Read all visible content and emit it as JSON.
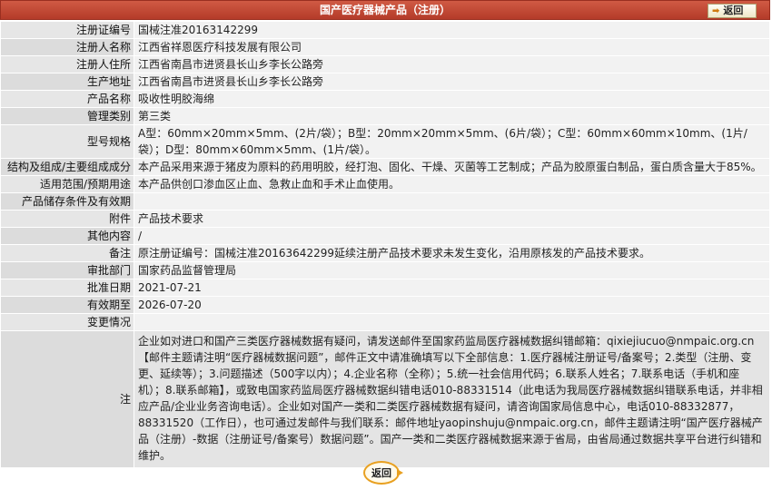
{
  "header": {
    "title": "国产医疗器械产品（注册）",
    "back_label": "返回"
  },
  "rows": [
    {
      "label": "注册证编号",
      "value": "国械注准20163142299"
    },
    {
      "label": "注册人名称",
      "value": "江西省祥恩医疗科技发展有限公司"
    },
    {
      "label": "注册人住所",
      "value": "江西省南昌市进贤县长山乡李长公路旁"
    },
    {
      "label": "生产地址",
      "value": "江西省南昌市进贤县长山乡李长公路旁"
    },
    {
      "label": "产品名称",
      "value": "吸收性明胶海绵"
    },
    {
      "label": "管理类别",
      "value": "第三类"
    },
    {
      "label": "型号规格",
      "value": "A型：60mm×20mm×5mm、(2片/袋）；B型：20mm×20mm×5mm、(6片/袋）；C型：60mm×60mm×10mm、(1片/袋）；D型：80mm×60mm×5mm、(1片/袋）。"
    },
    {
      "label": "结构及组成/主要组成成分",
      "value": "本产品采用来源于猪皮为原料的药用明胶，经打泡、固化、干燥、灭菌等工艺制成；产品为胶原蛋白制品，蛋白质含量大于85%。"
    },
    {
      "label": "适用范围/预期用途",
      "value": "本产品供创口渗血区止血、急救止血和手术止血使用。"
    },
    {
      "label": "产品储存条件及有效期",
      "value": ""
    },
    {
      "label": "附件",
      "value": "产品技术要求"
    },
    {
      "label": "其他内容",
      "value": "/"
    },
    {
      "label": "备注",
      "value": "原注册证编号：国械注准20163642299延续注册产品技术要求未发生变化，沿用原核发的产品技术要求。"
    },
    {
      "label": "审批部门",
      "value": "国家药品监督管理局"
    },
    {
      "label": "批准日期",
      "value": "2021-07-21"
    },
    {
      "label": "有效期至",
      "value": "2026-07-20"
    },
    {
      "label": "变更情况",
      "value": ""
    }
  ],
  "note": {
    "label": "注",
    "text": "企业如对进口和国产三类医疗器械数据有疑问，请发送邮件至国家药监局医疗器械数据纠错邮箱：qixiejiucuo@nmpaic.org.cn【邮件主题请注明“医疗器械数据问题”，邮件正文中请准确填写以下全部信息：1.医疗器械注册证号/备案号；2.类型（注册、变更、延续等）；3.问题描述（500字以内）；4.企业名称（全称）；5.统一社会信用代码；6.联系人姓名；7.联系电话（手机和座机）；8.联系邮箱】，或致电国家药监局医疗器械数据纠错电话010-88331514（此电话为我局医疗器械数据纠错联系电话，并非相应产品/企业业务咨询电话）。企业如对国产一类和二类医疗器械数据有疑问，请咨询国家局信息中心，电话010-88332877，88331520（工作日），也可通过发邮件与我们联系：邮件地址yaopinshuju@nmpaic.org.cn，邮件主题请注明“国产医疗器械产品（注册）-数据（注册证号/备案号）数据问题”。国产一类和二类医疗器械数据来源于省局，由省局通过数据共享平台进行纠错和维护。"
  },
  "footer": {
    "back_label": "返回"
  }
}
